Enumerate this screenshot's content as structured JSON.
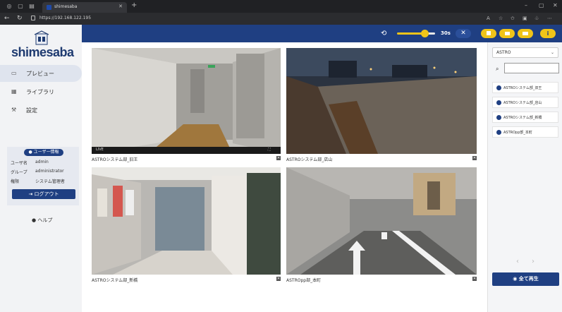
{
  "browser": {
    "tab_title": "shimesaba",
    "url": "https://192.168.122.195"
  },
  "sidebar": {
    "logo": "shimesaba",
    "items": [
      {
        "label": "プレビュー",
        "icon": "monitor-icon",
        "active": true
      },
      {
        "label": "ライブラリ",
        "icon": "library-icon",
        "active": false
      },
      {
        "label": "設定",
        "icon": "wrench-icon",
        "active": false
      }
    ],
    "user": {
      "header": "ユーザー情報",
      "rows": [
        {
          "key": "ユーザ名",
          "value": "admin"
        },
        {
          "key": "グループ",
          "value": "administrator"
        },
        {
          "key": "権限",
          "value": "システム管理者"
        }
      ],
      "logout_label": "ログアウト"
    },
    "help_label": "ヘルプ"
  },
  "controls": {
    "interval": "30s",
    "slider_fraction": 0.62
  },
  "cameras": [
    {
      "label": "ASTROシステム部_旧王",
      "overlay_left": "LIVE"
    },
    {
      "label": "ASTROシステム部_店山"
    },
    {
      "label": "ASTROシステム部_新橋"
    },
    {
      "label": "ASTROpp部_本町"
    }
  ],
  "right": {
    "select_value": "ASTRO",
    "search_placeholder": "",
    "items": [
      "ASTROシステム部_旧王",
      "ASTROシステム部_店山",
      "ASTROシステム部_新橋",
      "ASTROpp部_本町"
    ],
    "play_all_label": "全て再生"
  },
  "colors": {
    "primary": "#1f3f82",
    "accent": "#f0c419"
  }
}
